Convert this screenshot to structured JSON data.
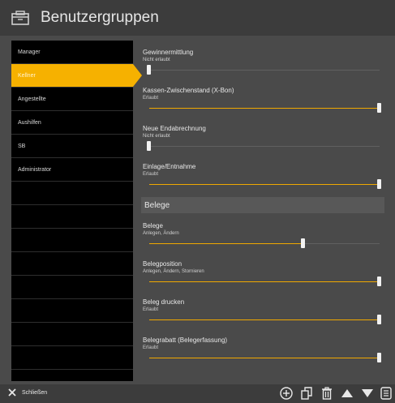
{
  "header": {
    "title": "Benutzergruppen",
    "icon": "user-groups-icon"
  },
  "sidebar": {
    "items": [
      {
        "label": "Manager",
        "active": false
      },
      {
        "label": "Kellner",
        "active": true
      },
      {
        "label": "Angestellte",
        "active": false
      },
      {
        "label": "Aushilfen",
        "active": false
      },
      {
        "label": "SB",
        "active": false
      },
      {
        "label": "Administrator",
        "active": false
      },
      {
        "label": "",
        "active": false
      },
      {
        "label": "",
        "active": false
      },
      {
        "label": "",
        "active": false
      },
      {
        "label": "",
        "active": false
      },
      {
        "label": "",
        "active": false
      },
      {
        "label": "",
        "active": false
      },
      {
        "label": "",
        "active": false
      },
      {
        "label": "",
        "active": false
      }
    ]
  },
  "permissions_top": [
    {
      "name": "Gewinnermittlung",
      "value": "Nicht erlaubt",
      "level": 0
    },
    {
      "name": "Kassen-Zwischenstand (X-Bon)",
      "value": "Erlaubt",
      "level": 1
    },
    {
      "name": "Neue Endabrechnung",
      "value": "Nicht erlaubt",
      "level": 0
    },
    {
      "name": "Einlage/Entnahme",
      "value": "Erlaubt",
      "level": 1
    }
  ],
  "section_belege": {
    "title": "Belege"
  },
  "permissions_belege": [
    {
      "name": "Belege",
      "value": "Anlegen, Ändern",
      "level": 0.67
    },
    {
      "name": "Belegposition",
      "value": "Anlegen, Ändern, Stornieren",
      "level": 1
    },
    {
      "name": "Beleg drucken",
      "value": "Erlaubt",
      "level": 1
    },
    {
      "name": "Belegrabatt (Belegerfassung)",
      "value": "Erlaubt",
      "level": 1
    }
  ],
  "footer": {
    "close_label": "Schließen",
    "icons": [
      "add-icon",
      "copy-icon",
      "delete-icon",
      "move-up-icon",
      "move-down-icon",
      "details-icon"
    ]
  },
  "colors": {
    "accent": "#f6b100",
    "background": "#4a4a4a",
    "sidebar": "#000000"
  }
}
